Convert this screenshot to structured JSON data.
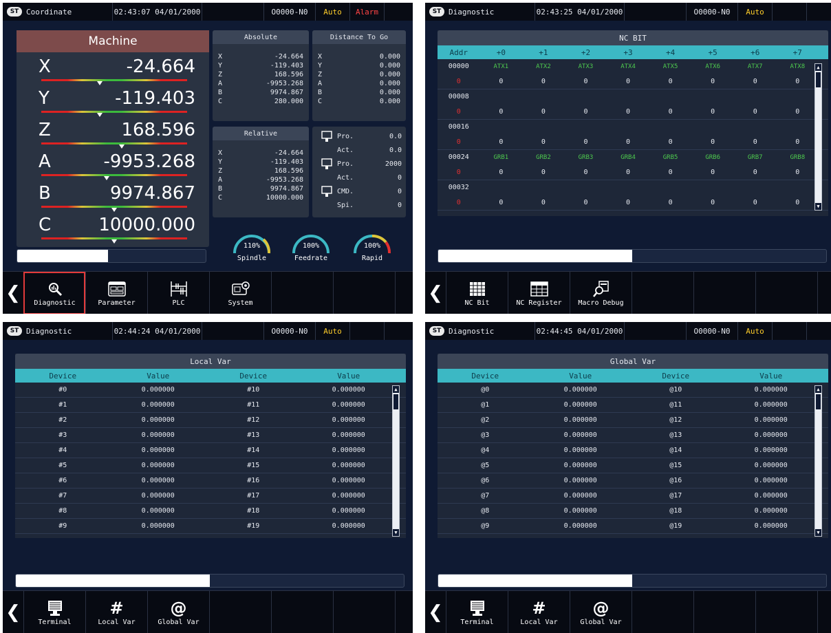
{
  "colors": {
    "bg": "#0f1a33",
    "header": "#080b14",
    "accent_cyan": "#3cb8c4",
    "auto": "#ffce2a",
    "alarm": "#ff4444",
    "machine_head": "#7d4b4b",
    "bit_label": "#4ec94e",
    "addr_zero": "#e23030"
  },
  "logo_text": "ST",
  "screen1": {
    "header": {
      "title": "Coordinate",
      "datetime": "02:43:07 04/01/2000",
      "program": "O0000-N0",
      "mode": "Auto",
      "alarm": "Alarm"
    },
    "machine": {
      "title": "Machine",
      "axes": [
        {
          "name": "X",
          "value": "-24.664",
          "mark": 0.4
        },
        {
          "name": "Y",
          "value": "-119.403",
          "mark": 0.4
        },
        {
          "name": "Z",
          "value": "168.596",
          "mark": 0.55
        },
        {
          "name": "A",
          "value": "-9953.268",
          "mark": 0.45
        },
        {
          "name": "B",
          "value": "9974.867",
          "mark": 0.5
        },
        {
          "name": "C",
          "value": "10000.000",
          "mark": 0.5
        }
      ]
    },
    "absolute": {
      "title": "Absolute",
      "rows": [
        [
          "X",
          "-24.664"
        ],
        [
          "Y",
          "-119.403"
        ],
        [
          "Z",
          "168.596"
        ],
        [
          "A",
          "-9953.268"
        ],
        [
          "B",
          "9974.867"
        ],
        [
          "C",
          "280.000"
        ]
      ]
    },
    "distance": {
      "title": "Distance To Go",
      "rows": [
        [
          "X",
          "0.000"
        ],
        [
          "Y",
          "0.000"
        ],
        [
          "Z",
          "0.000"
        ],
        [
          "A",
          "0.000"
        ],
        [
          "B",
          "0.000"
        ],
        [
          "C",
          "0.000"
        ]
      ]
    },
    "relative": {
      "title": "Relative",
      "rows": [
        [
          "X",
          "-24.664"
        ],
        [
          "Y",
          "-119.403"
        ],
        [
          "Z",
          "168.596"
        ],
        [
          "A",
          "-9953.268"
        ],
        [
          "B",
          "9974.867"
        ],
        [
          "C",
          "10000.000"
        ]
      ]
    },
    "status": [
      {
        "label": "Pro.",
        "value": "0.0"
      },
      {
        "label": "Act.",
        "value": "0.0"
      },
      {
        "label": "Pro.",
        "value": "2000"
      },
      {
        "label": "Act.",
        "value": "0"
      },
      {
        "label": "CMD.",
        "value": "0"
      },
      {
        "label": "Spi.",
        "value": "0"
      }
    ],
    "gauges": [
      {
        "value": "110%",
        "name": "Spindle",
        "ratio": 1.1
      },
      {
        "value": "100%",
        "name": "Feedrate",
        "ratio": 1.0
      },
      {
        "value": "100%",
        "name": "Rapid",
        "ratio": 1.0
      }
    ],
    "progress": 0.48,
    "softkeys": [
      "Diagnostic",
      "Parameter",
      "PLC",
      "System"
    ]
  },
  "screen2": {
    "header": {
      "title": "Diagnostic",
      "datetime": "02:43:25 04/01/2000",
      "program": "O0000-N0",
      "mode": "Auto"
    },
    "table_title": "NC BIT",
    "columns": [
      "Addr",
      "+0",
      "+1",
      "+2",
      "+3",
      "+4",
      "+5",
      "+6",
      "+7"
    ],
    "rows": [
      {
        "addr": "00000",
        "labels": [
          "ATX1",
          "ATX2",
          "ATX3",
          "ATX4",
          "ATX5",
          "ATX6",
          "ATX7",
          "ATX8"
        ],
        "marker": "0",
        "values": [
          "0",
          "0",
          "0",
          "0",
          "0",
          "0",
          "0",
          "0"
        ]
      },
      {
        "addr": "00008",
        "labels": [
          "",
          "",
          "",
          "",
          "",
          "",
          "",
          ""
        ],
        "marker": "0",
        "values": [
          "0",
          "0",
          "0",
          "0",
          "0",
          "0",
          "0",
          "0"
        ]
      },
      {
        "addr": "00016",
        "labels": [
          "",
          "",
          "",
          "",
          "",
          "",
          "",
          ""
        ],
        "marker": "0",
        "values": [
          "0",
          "0",
          "0",
          "0",
          "0",
          "0",
          "0",
          "0"
        ]
      },
      {
        "addr": "00024",
        "labels": [
          "GRB1",
          "GRB2",
          "GRB3",
          "GRB4",
          "GRB5",
          "GRB6",
          "GRB7",
          "GRB8"
        ],
        "marker": "0",
        "values": [
          "0",
          "0",
          "0",
          "0",
          "0",
          "0",
          "0",
          "0"
        ]
      },
      {
        "addr": "00032",
        "labels": [
          "",
          "",
          "",
          "",
          "",
          "",
          "",
          ""
        ],
        "marker": "0",
        "values": [
          "0",
          "0",
          "0",
          "0",
          "0",
          "0",
          "0",
          "0"
        ]
      }
    ],
    "progress": 0.5,
    "softkeys": [
      "NC Bit",
      "NC Register",
      "Macro Debug"
    ]
  },
  "screen3": {
    "header": {
      "title": "Diagnostic",
      "datetime": "02:44:24 04/01/2000",
      "program": "O0000-N0",
      "mode": "Auto"
    },
    "table_title": "Local Var",
    "columns": [
      "Device",
      "Value",
      "Device",
      "Value"
    ],
    "rows": [
      [
        "#0",
        "0.000000",
        "#10",
        "0.000000"
      ],
      [
        "#1",
        "0.000000",
        "#11",
        "0.000000"
      ],
      [
        "#2",
        "0.000000",
        "#12",
        "0.000000"
      ],
      [
        "#3",
        "0.000000",
        "#13",
        "0.000000"
      ],
      [
        "#4",
        "0.000000",
        "#14",
        "0.000000"
      ],
      [
        "#5",
        "0.000000",
        "#15",
        "0.000000"
      ],
      [
        "#6",
        "0.000000",
        "#16",
        "0.000000"
      ],
      [
        "#7",
        "0.000000",
        "#17",
        "0.000000"
      ],
      [
        "#8",
        "0.000000",
        "#18",
        "0.000000"
      ],
      [
        "#9",
        "0.000000",
        "#19",
        "0.000000"
      ]
    ],
    "progress": 0.5,
    "softkeys": [
      "Terminal",
      "Local Var",
      "Global Var"
    ]
  },
  "screen4": {
    "header": {
      "title": "Diagnostic",
      "datetime": "02:44:45 04/01/2000",
      "program": "O0000-N0",
      "mode": "Auto"
    },
    "table_title": "Global Var",
    "columns": [
      "Device",
      "Value",
      "Device",
      "Value"
    ],
    "rows": [
      [
        "@0",
        "0.000000",
        "@10",
        "0.000000"
      ],
      [
        "@1",
        "0.000000",
        "@11",
        "0.000000"
      ],
      [
        "@2",
        "0.000000",
        "@12",
        "0.000000"
      ],
      [
        "@3",
        "0.000000",
        "@13",
        "0.000000"
      ],
      [
        "@4",
        "0.000000",
        "@14",
        "0.000000"
      ],
      [
        "@5",
        "0.000000",
        "@15",
        "0.000000"
      ],
      [
        "@6",
        "0.000000",
        "@16",
        "0.000000"
      ],
      [
        "@7",
        "0.000000",
        "@17",
        "0.000000"
      ],
      [
        "@8",
        "0.000000",
        "@18",
        "0.000000"
      ],
      [
        "@9",
        "0.000000",
        "@19",
        "0.000000"
      ]
    ],
    "progress": 0.5,
    "softkeys": [
      "Terminal",
      "Local Var",
      "Global Var"
    ]
  }
}
